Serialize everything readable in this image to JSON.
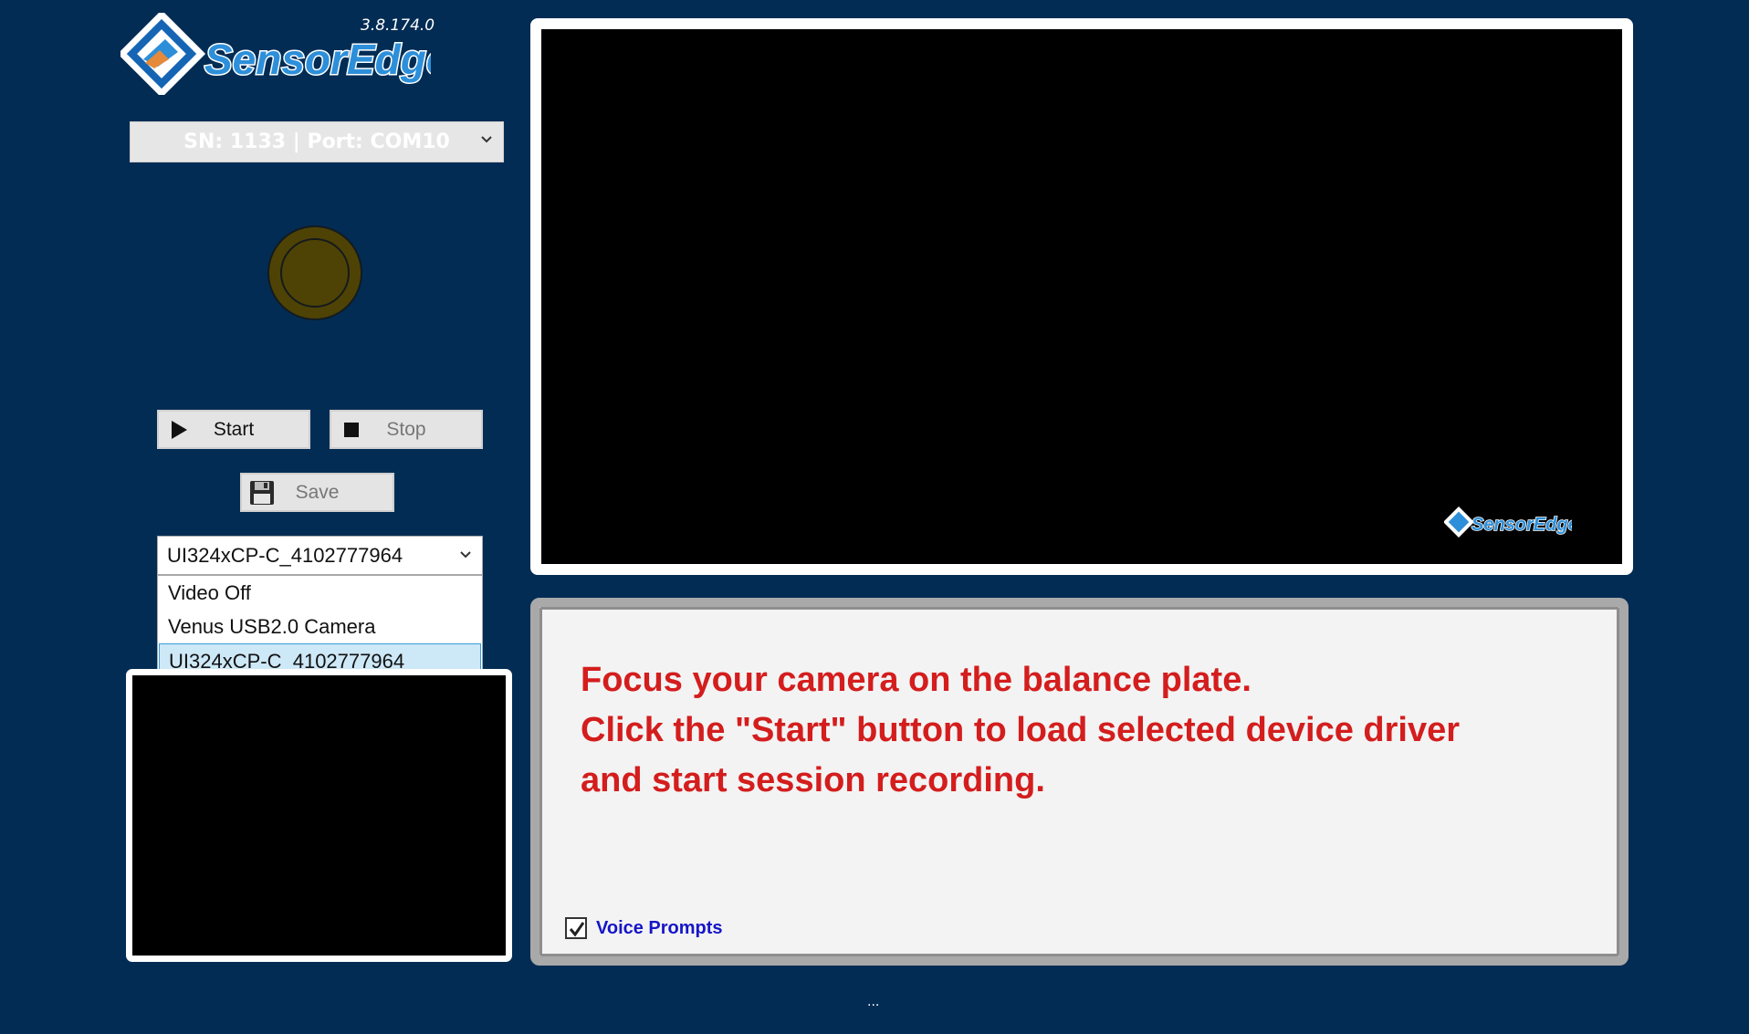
{
  "app": {
    "logo_text": "SensorEdge",
    "version": "3.8.174.0"
  },
  "device_select": {
    "value": "SN: 1133 | Port: COM10"
  },
  "controls": {
    "start_label": "Start",
    "stop_label": "Stop",
    "save_label": "Save"
  },
  "camera_select": {
    "value": "UI324xCP-C_4102777964",
    "options": [
      {
        "label": "Video Off",
        "selected": false
      },
      {
        "label": "Venus USB2.0 Camera",
        "selected": false
      },
      {
        "label": "UI324xCP-C_4102777964",
        "selected": true
      }
    ]
  },
  "main_video": {
    "watermark": "SensorEdge"
  },
  "message": {
    "lines": [
      "Focus your camera on the balance plate.",
      "Click the \"Start\" button to load selected device driver",
      "and start session recording."
    ]
  },
  "voice_prompts": {
    "label": "Voice Prompts",
    "checked": true
  },
  "status": {
    "text": "..."
  },
  "colors": {
    "background": "#022c54",
    "message_text": "#d41d1d",
    "voice_label": "#1515c8",
    "lamp": "#4e4304"
  },
  "icons": {
    "play": "play-icon",
    "stop": "stop-icon",
    "save": "floppy-disk-icon",
    "dropdown": "chevron-down-icon",
    "check": "checkmark-icon"
  }
}
